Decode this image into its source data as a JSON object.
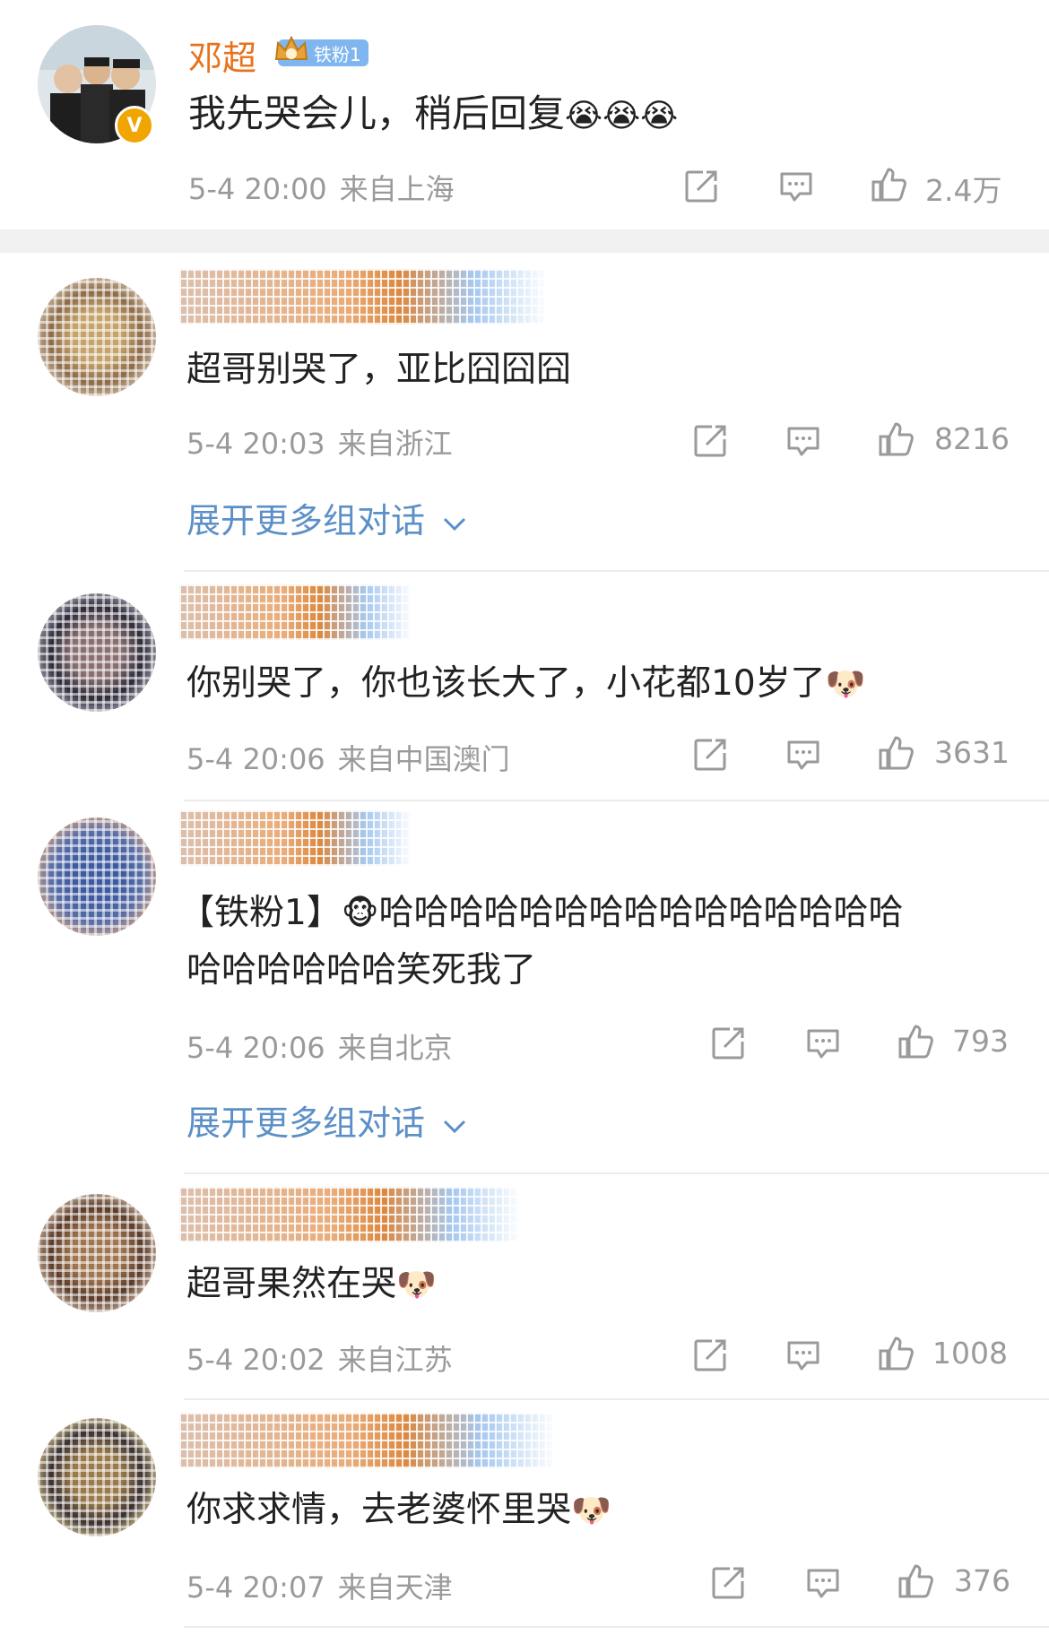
{
  "post": {
    "username": "邓超",
    "fan_badge": "铁粉1",
    "text": "我先哭会儿，稍后回复",
    "emojis": "😭😭😭",
    "time": "5-4 20:00",
    "source": "来自上海",
    "likes": "2.4万"
  },
  "comments": [
    {
      "text": "超哥别哭了，亚比囧囧囧",
      "emoji": "",
      "time": "5-4 20:03",
      "source": "来自浙江",
      "likes": "8216",
      "expand": "展开更多组对话"
    },
    {
      "text": "你别哭了，你也该长大了，小花都10岁了",
      "emoji": "🐶",
      "time": "5-4 20:06",
      "source": "来自中国澳门",
      "likes": "3631",
      "expand": ""
    },
    {
      "prefix": "【铁粉1】",
      "emoji_inline": "🐵",
      "line1": "哈哈哈哈哈哈哈哈哈哈哈哈哈哈哈",
      "line2": "哈哈哈哈哈哈笑死我了",
      "time": "5-4 20:06",
      "source": "来自北京",
      "likes": "793",
      "expand": "展开更多组对话"
    },
    {
      "text": "超哥果然在哭",
      "emoji": "🐶",
      "time": "5-4 20:02",
      "source": "来自江苏",
      "likes": "1008",
      "expand": ""
    },
    {
      "text": "你求求情，去老婆怀里哭",
      "emoji": "🐶",
      "time": "5-4 20:07",
      "source": "来自天津",
      "likes": "376",
      "expand": ""
    }
  ],
  "icons": {
    "share": "share-icon",
    "comment": "comment-icon",
    "like": "thumbs-up-icon",
    "expand": "chevron-down-icon"
  },
  "colors": {
    "username": "#e8721c",
    "link": "#5b8fc7",
    "meta": "#9a9a9a"
  }
}
